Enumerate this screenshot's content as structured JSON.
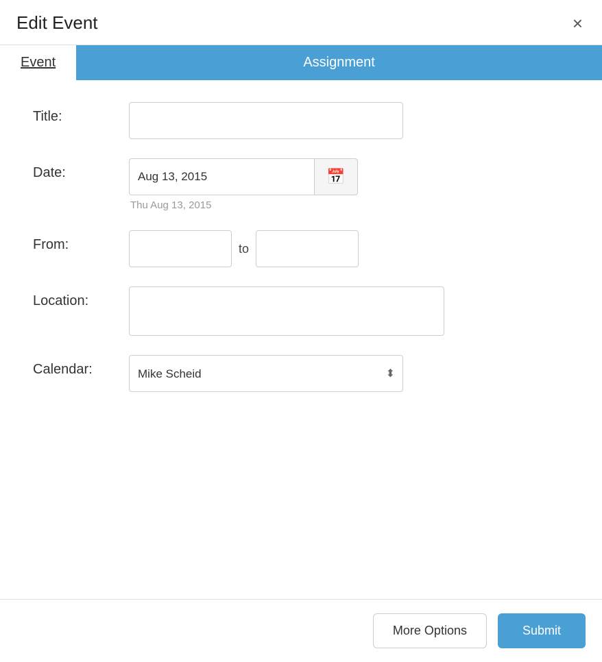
{
  "dialog": {
    "title": "Edit Event",
    "close_label": "×"
  },
  "tabs": {
    "event_label": "Event",
    "assignment_label": "Assignment"
  },
  "form": {
    "title_label": "Title:",
    "title_placeholder": "",
    "date_label": "Date:",
    "date_value": "Aug 13, 2015",
    "date_hint": "Thu Aug 13, 2015",
    "calendar_icon": "📅",
    "from_label": "From:",
    "from_placeholder": "",
    "to_label": "to",
    "to_placeholder": "",
    "location_label": "Location:",
    "location_placeholder": "",
    "calendar_label": "Calendar:",
    "calendar_selected": "Mike Scheid",
    "calendar_options": [
      "Mike Scheid"
    ]
  },
  "footer": {
    "more_options_label": "More Options",
    "submit_label": "Submit"
  }
}
